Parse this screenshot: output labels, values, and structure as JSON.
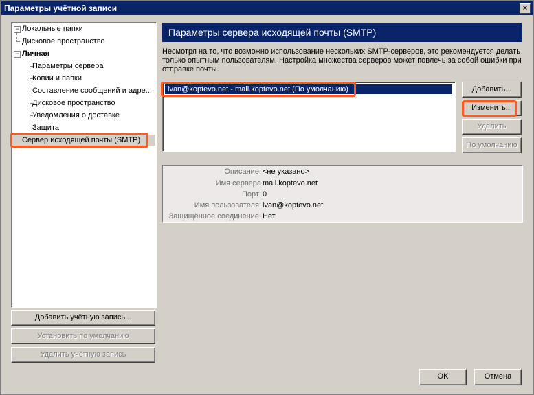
{
  "window": {
    "title": "Параметры учётной записи",
    "close_glyph": "×"
  },
  "tree": {
    "items": [
      {
        "label": "Локальные папки",
        "bold": false
      },
      {
        "label": "Дисковое пространство"
      },
      {
        "label": "Личная",
        "bold": true
      },
      {
        "label": "Параметры сервера"
      },
      {
        "label": "Копии и папки"
      },
      {
        "label": "Составление сообщений и адре..."
      },
      {
        "label": "Дисковое пространство"
      },
      {
        "label": "Уведомления о доставке"
      },
      {
        "label": "Защита"
      },
      {
        "label": "Сервер исходящей почты (SMTP)",
        "selected": true
      }
    ],
    "expander_glyph": "−"
  },
  "left_buttons": {
    "add": "Добавить учётную запись...",
    "set_default": "Установить по умолчанию",
    "delete": "Удалить учётную запись"
  },
  "main": {
    "header": "Параметры сервера исходящей почты (SMTP)",
    "description": "Несмотря на то, что возможно использование нескольких SMTP-серверов, это рекомендуется делать только опытным пользователям. Настройка множества серверов может повлечь за собой ошибки при отправке почты.",
    "server_list": [
      "ivan@koptevo.net - mail.koptevo.net (По умолчанию)"
    ],
    "buttons": {
      "add": "Добавить...",
      "edit": "Изменить...",
      "delete": "Удалить",
      "default": "По умолчанию"
    },
    "details": [
      {
        "label": "Описание:",
        "value": "<не указано>"
      },
      {
        "label": "Имя сервера",
        "value": "mail.koptevo.net"
      },
      {
        "label": "Порт:",
        "value": "0"
      },
      {
        "label": "Имя пользователя:",
        "value": "ivan@koptevo.net"
      },
      {
        "label": "Защищённое соединение:",
        "value": "Нет"
      }
    ]
  },
  "footer": {
    "ok": "OK",
    "cancel": "Отмена"
  },
  "colors": {
    "titlebar": "#0a246a",
    "highlight": "#ff5a1f",
    "face": "#d4d0c8"
  }
}
